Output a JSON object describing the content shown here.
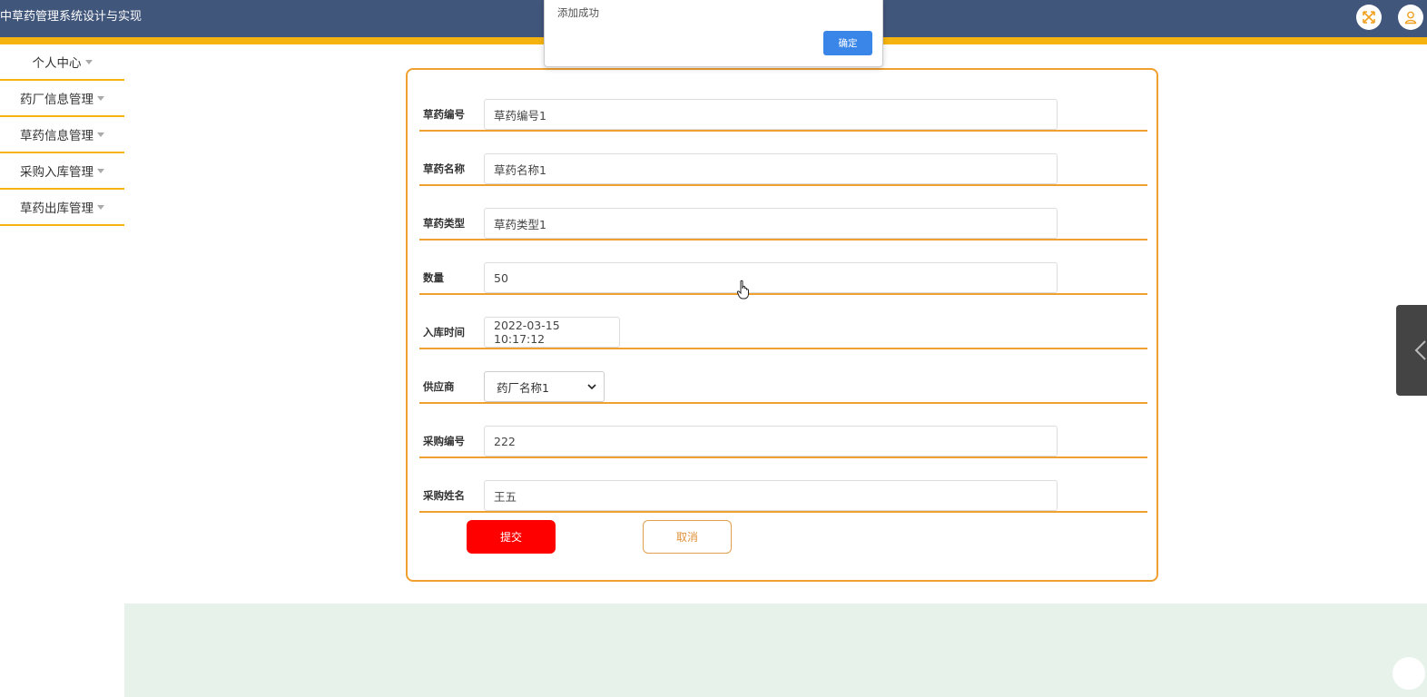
{
  "app": {
    "title": "中草药管理系统设计与实现"
  },
  "header": {
    "fullscreen_icon": "fullscreen-icon",
    "user_icon": "user-icon",
    "accent_color": "#f5b30f",
    "bar_color": "#41567b"
  },
  "sidebar": {
    "items": [
      {
        "label": "个人中心"
      },
      {
        "label": "药厂信息管理"
      },
      {
        "label": "草药信息管理"
      },
      {
        "label": "采购入库管理"
      },
      {
        "label": "草药出库管理"
      }
    ]
  },
  "form": {
    "fields": [
      {
        "label": "草药编号",
        "value": "草药编号1"
      },
      {
        "label": "草药名称",
        "value": "草药名称1"
      },
      {
        "label": "草药类型",
        "value": "草药类型1"
      },
      {
        "label": "数量",
        "value": "50"
      },
      {
        "label": "入库时间",
        "value": "2022-03-15 10:17:12"
      },
      {
        "label": "供应商",
        "value": "药厂名称1"
      },
      {
        "label": "采购编号",
        "value": "222"
      },
      {
        "label": "采购姓名",
        "value": "王五"
      }
    ],
    "submit_label": "提交",
    "cancel_label": "取消"
  },
  "alert": {
    "message": "添加成功",
    "ok_label": "确定"
  }
}
